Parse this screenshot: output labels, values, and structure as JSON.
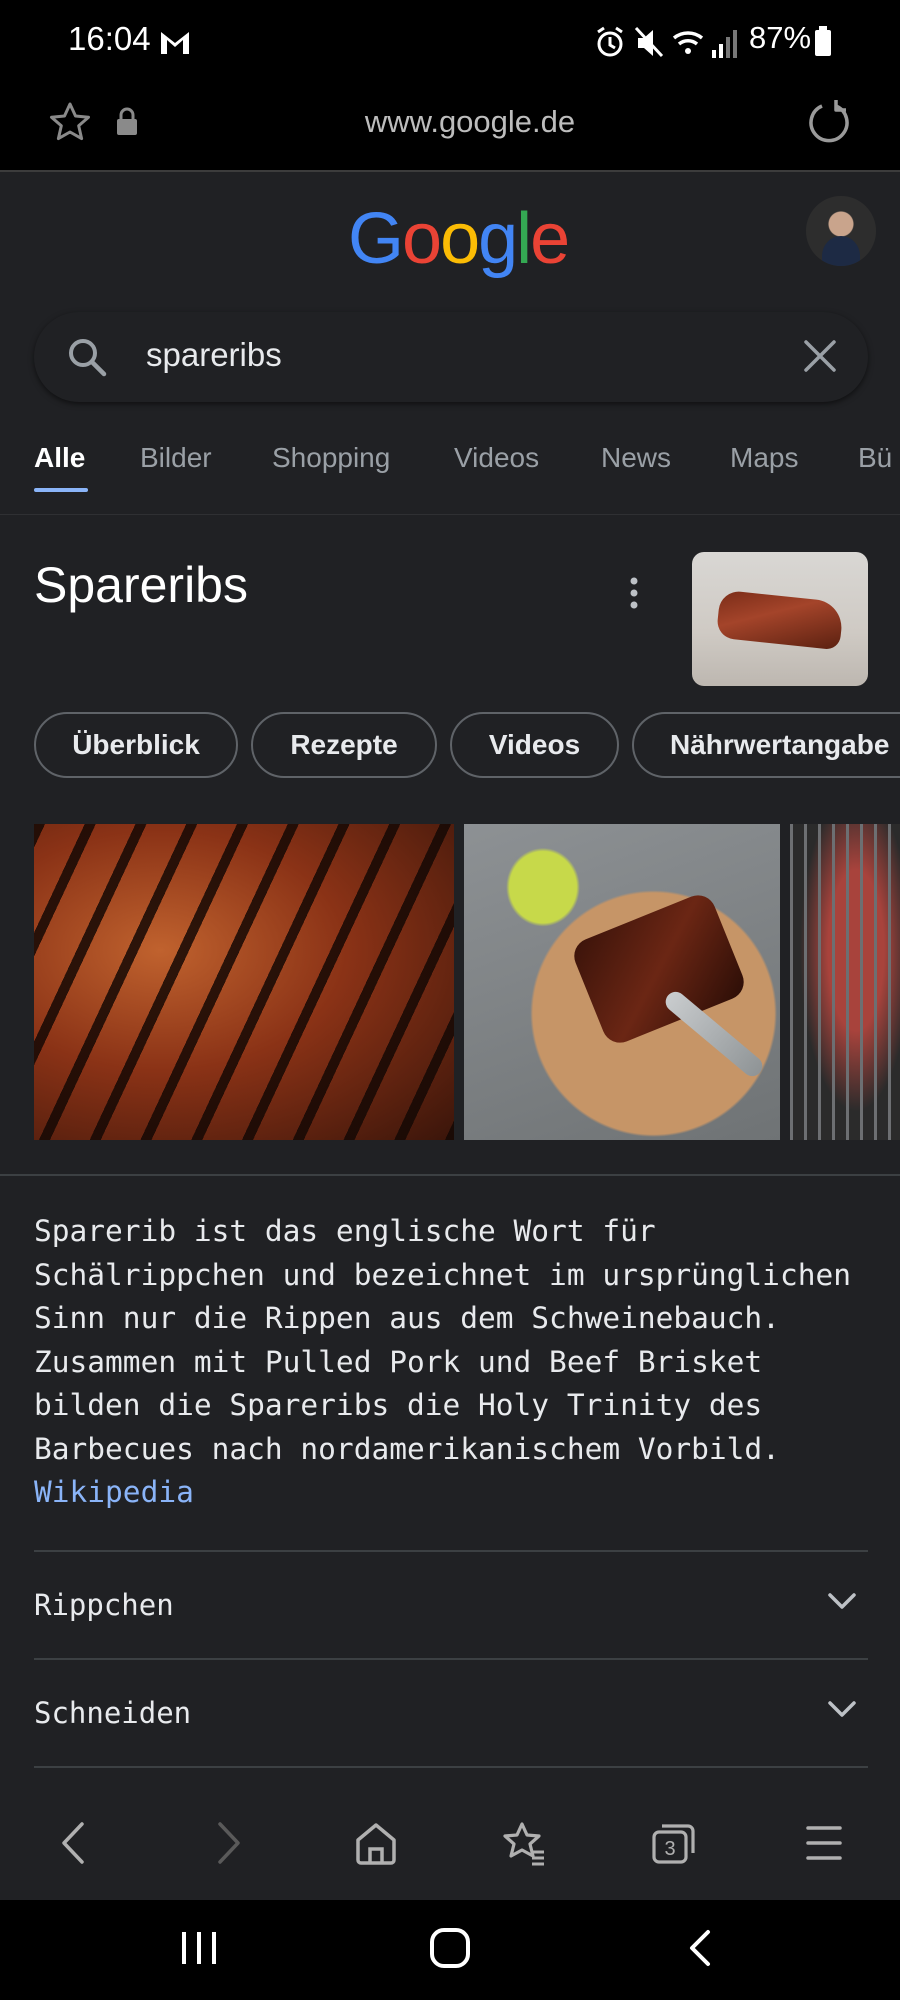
{
  "status_bar": {
    "time": "16:04",
    "battery": "87%",
    "icons": [
      "gmail-icon",
      "alarm-icon",
      "mute-icon",
      "wifi-icon",
      "signal-icon",
      "battery-icon"
    ]
  },
  "url_bar": {
    "url": "www.google.de"
  },
  "header": {
    "logo_letters": [
      "G",
      "o",
      "o",
      "g",
      "l",
      "e"
    ],
    "logo_colors": [
      "#4285f4",
      "#ea4335",
      "#fbbc05",
      "#4285f4",
      "#34a853",
      "#ea4335"
    ]
  },
  "search": {
    "query": "spareribs"
  },
  "tabs": [
    {
      "label": "Alle",
      "active": true
    },
    {
      "label": "Bilder",
      "active": false
    },
    {
      "label": "Shopping",
      "active": false
    },
    {
      "label": "Videos",
      "active": false
    },
    {
      "label": "News",
      "active": false
    },
    {
      "label": "Maps",
      "active": false
    },
    {
      "label": "Bü",
      "active": false
    }
  ],
  "knowledge": {
    "title": "Spareribs",
    "chips": [
      "Überblick",
      "Rezepte",
      "Videos",
      "Nährwertangabe"
    ],
    "description": "Sparerib ist das englische Wort für Schälrippchen und bezeichnet im ursprünglichen Sinn nur die Rippen aus dem Schweinebauch. Zusammen mit Pulled Pork und Beef Brisket bilden die Spareribs die Holy Trinity des Barbecues nach nordamerikanischem Vorbild.",
    "source": "Wikipedia",
    "sections": [
      "Rippchen",
      "Schneiden"
    ]
  },
  "colors": {
    "background": "#202124",
    "accent": "#8ab4f8",
    "text": "#e8eaed",
    "muted": "#9aa0a6"
  }
}
